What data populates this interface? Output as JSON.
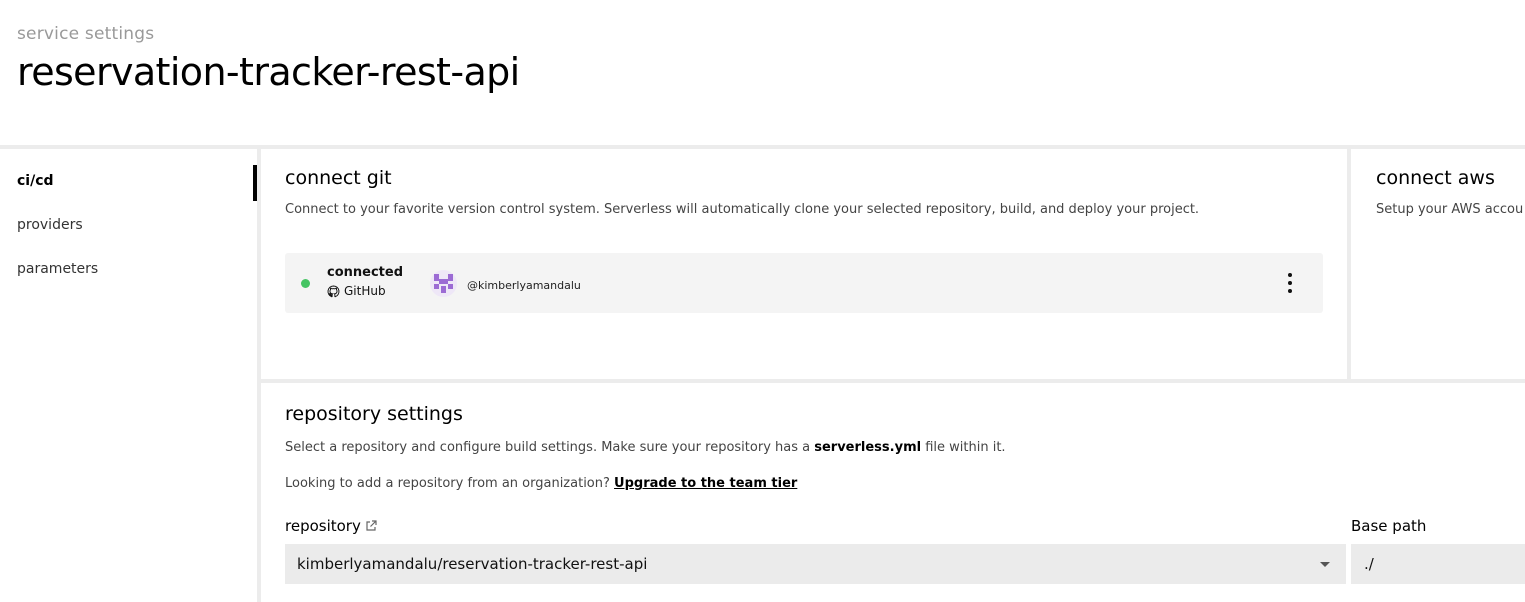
{
  "header": {
    "subtitle": "service settings",
    "title": "reservation-tracker-rest-api"
  },
  "sidebar": {
    "items": [
      {
        "label": "ci/cd",
        "active": true
      },
      {
        "label": "providers",
        "active": false
      },
      {
        "label": "parameters",
        "active": false
      }
    ]
  },
  "connect_git": {
    "title": "connect git",
    "description": "Connect to your favorite version control system. Serverless will automatically clone your selected repository, build, and deploy your project.",
    "connection": {
      "status": "connected",
      "status_color": "#45c463",
      "provider": "GitHub",
      "provider_icon": "github-icon",
      "username": "@kimberlyamandalu",
      "menu_icon": "kebab-menu-icon"
    }
  },
  "connect_aws": {
    "title": "connect aws",
    "description": "Setup your AWS accou"
  },
  "repository_settings": {
    "title": "repository settings",
    "description_prefix": "Select a repository and configure build settings. Make sure your repository has a ",
    "description_file": "serverless.yml",
    "description_suffix": " file within it.",
    "org_prompt": "Looking to add a repository from an organization?",
    "upgrade_link": "Upgrade to the team tier",
    "repository_label": "repository",
    "repository_icon": "external-link-icon",
    "repository_value": "kimberlyamandalu/reservation-tracker-rest-api",
    "base_path_label": "Base path",
    "base_path_value": "./"
  }
}
